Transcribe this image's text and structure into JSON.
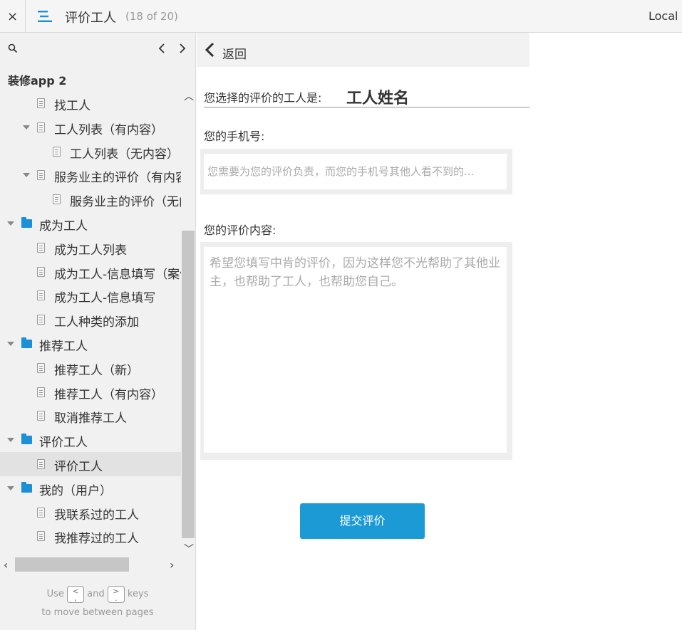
{
  "topbar": {
    "close_label": "×",
    "page_title": "评价工人",
    "page_count": "(18 of 20)",
    "right_label": "Local F"
  },
  "sidebar": {
    "project_name": "装修app 2",
    "items": [
      {
        "label": "找工人",
        "type": "page",
        "indent": 2,
        "expanded": null
      },
      {
        "label": "工人列表（有内容）",
        "type": "page",
        "indent": 2,
        "expanded": true
      },
      {
        "label": "工人列表（无内容）",
        "type": "page",
        "indent": 3,
        "expanded": null
      },
      {
        "label": "服务业主的评价（有内容）",
        "type": "page",
        "indent": 2,
        "expanded": true
      },
      {
        "label": "服务业主的评价（无内容）",
        "type": "page",
        "indent": 3,
        "expanded": null
      },
      {
        "label": "成为工人",
        "type": "folder",
        "indent": 1,
        "expanded": true
      },
      {
        "label": "成为工人列表",
        "type": "page",
        "indent": 2,
        "expanded": null
      },
      {
        "label": "成为工人-信息填写（案例）",
        "type": "page",
        "indent": 2,
        "expanded": null
      },
      {
        "label": "成为工人-信息填写",
        "type": "page",
        "indent": 2,
        "expanded": null
      },
      {
        "label": "工人种类的添加",
        "type": "page",
        "indent": 2,
        "expanded": null
      },
      {
        "label": "推荐工人",
        "type": "folder",
        "indent": 1,
        "expanded": true
      },
      {
        "label": "推荐工人（新）",
        "type": "page",
        "indent": 2,
        "expanded": null
      },
      {
        "label": "推荐工人（有内容）",
        "type": "page",
        "indent": 2,
        "expanded": null
      },
      {
        "label": "取消推荐工人",
        "type": "page",
        "indent": 2,
        "expanded": null
      },
      {
        "label": "评价工人",
        "type": "folder",
        "indent": 1,
        "expanded": true
      },
      {
        "label": "评价工人",
        "type": "page",
        "indent": 2,
        "expanded": null,
        "active": true
      },
      {
        "label": "我的（用户）",
        "type": "folder",
        "indent": 1,
        "expanded": true
      },
      {
        "label": "我联系过的工人",
        "type": "page",
        "indent": 2,
        "expanded": null
      },
      {
        "label": "我推荐过的工人",
        "type": "page",
        "indent": 2,
        "expanded": null
      }
    ],
    "hint": {
      "use": "Use",
      "key_prev": "<\n,",
      "and": "and",
      "key_next": ">\n.",
      "keys": "keys",
      "line2": "to move between pages"
    }
  },
  "main": {
    "back_label": "返回",
    "worker_label": "您选择的评价的工人是:",
    "worker_name": "工人姓名",
    "phone_label": "您的手机号:",
    "phone_placeholder": "您需要为您的评价负责，而您的手机号其他人看不到的...",
    "review_label": "您的评价内容:",
    "review_placeholder": "希望您填写中肯的评价，因为这样您不光帮助了其他业主，也帮助了工人，也帮助您自己。",
    "submit_label": "提交评价"
  },
  "colors": {
    "accent": "#1b9ad6",
    "folder": "#1b8fd8",
    "sidebar_bg": "#f1f1f1"
  }
}
